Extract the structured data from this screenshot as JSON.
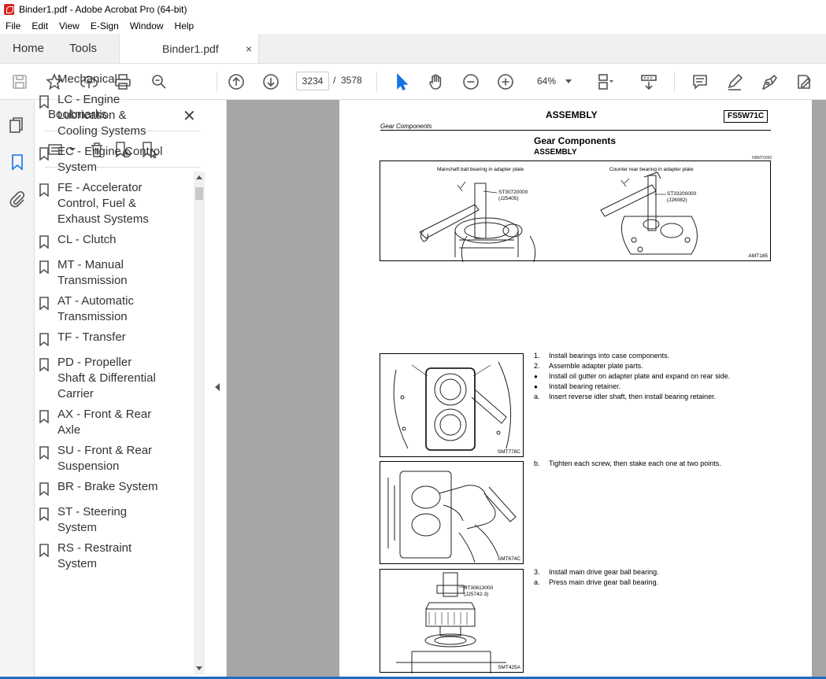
{
  "window": {
    "title": "Binder1.pdf - Adobe Acrobat Pro (64-bit)"
  },
  "menu": [
    "File",
    "Edit",
    "View",
    "E-Sign",
    "Window",
    "Help"
  ],
  "tabs": {
    "home": "Home",
    "tools": "Tools",
    "document": "Binder1.pdf",
    "close": "×"
  },
  "toolbar": {
    "current_page": "3234",
    "separator": "/",
    "total_pages": "3578",
    "zoom": "64%"
  },
  "bookmarks": {
    "title": "Bookmarks",
    "close": "✕",
    "partial_item": "Mechanical",
    "items": [
      {
        "label": "LC - Engine Lubrication & Cooling Systems"
      },
      {
        "label": "EC - Engine Control System"
      },
      {
        "label": "FE - Accelerator Control, Fuel & Exhaust Systems"
      },
      {
        "label": "CL - Clutch"
      },
      {
        "label": "MT - Manual Transmission"
      },
      {
        "label": "AT - Automatic Transmission"
      },
      {
        "label": "TF - Transfer"
      },
      {
        "label": "PD - Propeller Shaft & Differential Carrier"
      },
      {
        "label": "AX - Front & Rear Axle"
      },
      {
        "label": "SU - Front & Rear Suspension"
      },
      {
        "label": "BR - Brake System"
      },
      {
        "label": "ST - Steering System"
      },
      {
        "label": "RS - Restraint System"
      }
    ]
  },
  "page": {
    "title": "ASSEMBLY",
    "code": "FS5W71C",
    "running_head": "Gear Components",
    "section_title": "Gear Components",
    "section_subtitle": "ASSEMBLY",
    "ref_code": "NBMT0060",
    "figure1": {
      "caption_left": "Mainshaft ball bearing in adapter plate",
      "tool_left": "ST30720000",
      "tool_left_alt": "(J25405)",
      "caption_right": "Counter rear bearing in adapter plate",
      "tool_right": "ST33200000",
      "tool_right_alt": "(J26082)",
      "code": "AMT185"
    },
    "figure2_code": "SMT778C",
    "figure3_code": "SMT674C",
    "figure4": {
      "tool": "ST30613000",
      "tool_alt": "(J25742-3)",
      "code": "SMT425A"
    },
    "steps_a": [
      {
        "n": "1.",
        "t": "Install bearings into case components."
      },
      {
        "n": "2.",
        "t": "Assemble adapter plate parts."
      },
      {
        "n": "●",
        "t": "Install oil gutter on adapter plate and expand on rear side."
      },
      {
        "n": "●",
        "t": "Install bearing retainer."
      },
      {
        "n": "a.",
        "t": "Insert reverse idler shaft, then install bearing retainer."
      }
    ],
    "steps_b": [
      {
        "n": "b.",
        "t": "Tighten each screw, then stake each one at two points."
      }
    ],
    "steps_c": [
      {
        "n": "3.",
        "t": "Install main drive gear ball bearing."
      },
      {
        "n": "a.",
        "t": "Press main drive gear ball bearing."
      }
    ]
  }
}
